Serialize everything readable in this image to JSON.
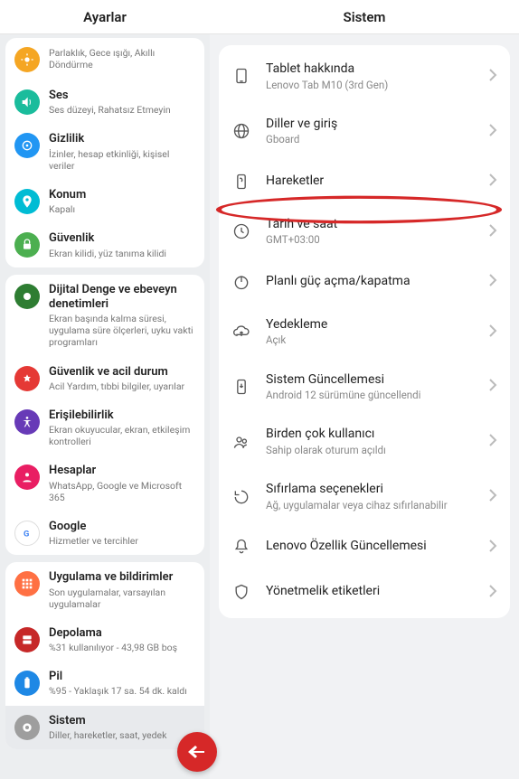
{
  "header": {
    "left": "Ayarlar",
    "right": "Sistem"
  },
  "sidebar": {
    "groups": [
      {
        "items": [
          {
            "title": "",
            "sub": "Parlaklık, Gece ışığı, Akıllı Döndürme"
          },
          {
            "title": "Ses",
            "sub": "Ses düzeyi, Rahatsız Etmeyin"
          },
          {
            "title": "Gizlilik",
            "sub": "İzinler, hesap etkinliği, kişisel veriler"
          },
          {
            "title": "Konum",
            "sub": "Kapalı"
          },
          {
            "title": "Güvenlik",
            "sub": "Ekran kilidi, yüz tanıma kilidi"
          }
        ]
      },
      {
        "items": [
          {
            "title": "Dijital Denge ve ebeveyn denetimleri",
            "sub": "Ekran başında kalma süresi, uygulama süre ölçerleri, uyku vakti programları"
          },
          {
            "title": "Güvenlik ve acil durum",
            "sub": "Acil Yardım, tıbbi bilgiler, uyarılar"
          },
          {
            "title": "Erişilebilirlik",
            "sub": "Ekran okuyucular, ekran, etkileşim kontrolleri"
          },
          {
            "title": "Hesaplar",
            "sub": "WhatsApp, Google ve Microsoft 365"
          },
          {
            "title": "Google",
            "sub": "Hizmetler ve tercihler"
          }
        ]
      },
      {
        "items": [
          {
            "title": "Uygulama ve bildirimler",
            "sub": "Son uygulamalar, varsayılan uygulamalar"
          },
          {
            "title": "Depolama",
            "sub": "%31 kullanılıyor - 43,98 GB boş"
          },
          {
            "title": "Pil",
            "sub": "%95 - Yaklaşık 17 sa. 54 dk. kaldı"
          },
          {
            "title": "Sistem",
            "sub": "Diller, hareketler, saat, yedek"
          }
        ]
      }
    ]
  },
  "detail": {
    "items": [
      {
        "title": "Tablet hakkında",
        "sub": "Lenovo Tab M10 (3rd Gen)"
      },
      {
        "title": "Diller ve giriş",
        "sub": "Gboard"
      },
      {
        "title": "Hareketler",
        "sub": ""
      },
      {
        "title": "Tarih ve saat",
        "sub": "GMT+03:00"
      },
      {
        "title": "Planlı güç açma/kapatma",
        "sub": ""
      },
      {
        "title": "Yedekleme",
        "sub": "Açık"
      },
      {
        "title": "Sistem Güncellemesi",
        "sub": "Android 12 sürümüne güncellendi"
      },
      {
        "title": "Birden çok kullanıcı",
        "sub": "Sahip olarak oturum açıldı"
      },
      {
        "title": "Sıfırlama seçenekleri",
        "sub": "Ağ, uygulamalar veya cihaz sıfırlanabilir"
      },
      {
        "title": "Lenovo Özellik Güncellemesi",
        "sub": ""
      },
      {
        "title": "Yönetmelik etiketleri",
        "sub": ""
      }
    ]
  }
}
